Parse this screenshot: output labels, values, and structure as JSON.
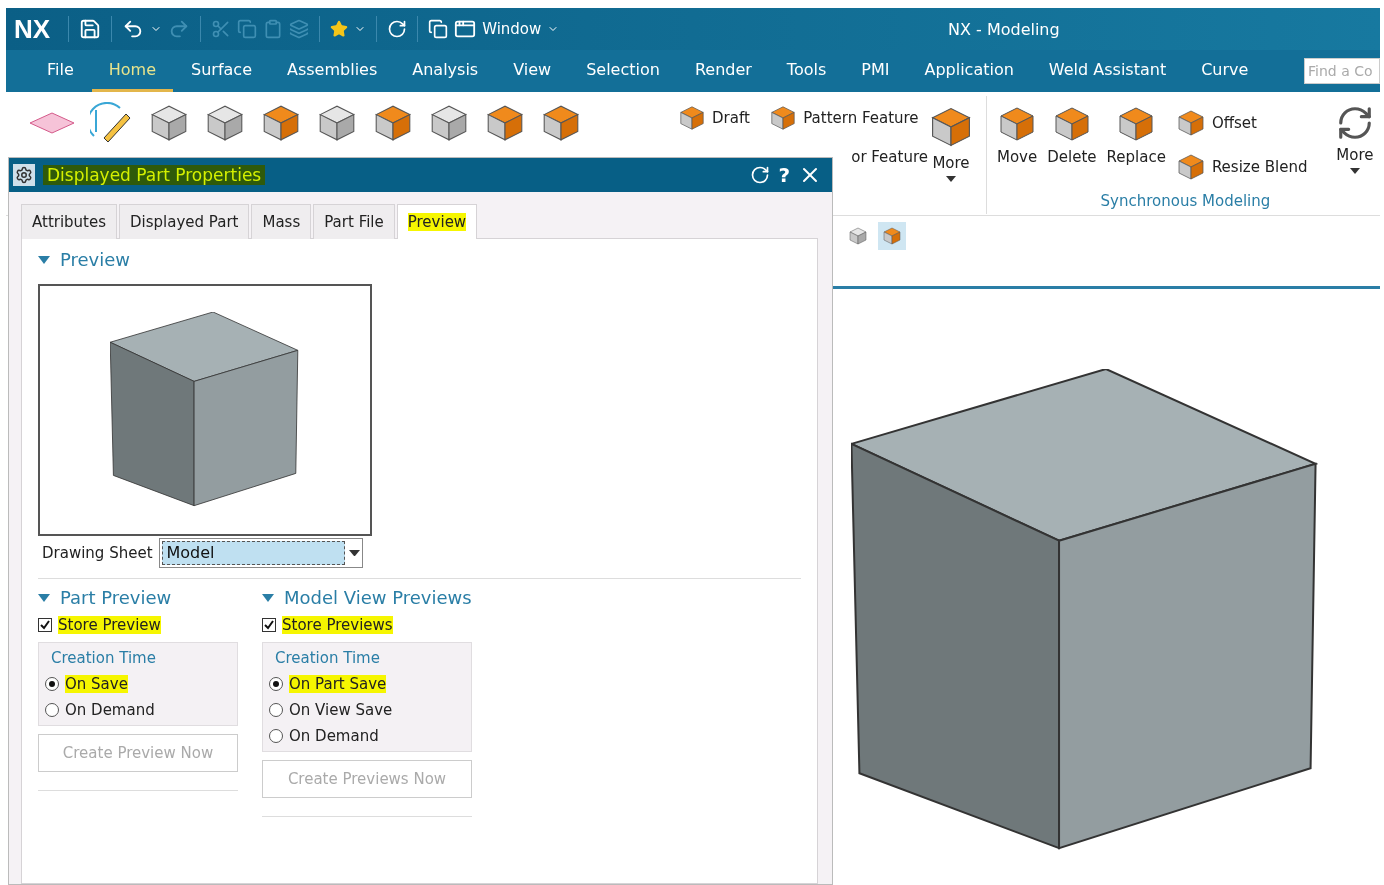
{
  "app": {
    "logo": "NX",
    "window_menu": "Window",
    "title": "NX - Modeling"
  },
  "menu_tabs": [
    {
      "label": "File",
      "selected": false
    },
    {
      "label": "Home",
      "selected": true
    },
    {
      "label": "Surface",
      "selected": false
    },
    {
      "label": "Assemblies",
      "selected": false
    },
    {
      "label": "Analysis",
      "selected": false
    },
    {
      "label": "View",
      "selected": false
    },
    {
      "label": "Selection",
      "selected": false
    },
    {
      "label": "Render",
      "selected": false
    },
    {
      "label": "Tools",
      "selected": false
    },
    {
      "label": "PMI",
      "selected": false
    },
    {
      "label": "Application",
      "selected": false
    },
    {
      "label": "Weld Assistant",
      "selected": false
    },
    {
      "label": "Curve",
      "selected": false
    }
  ],
  "search": {
    "placeholder": "Find a Co"
  },
  "ribbon": {
    "feature_tools": [
      "Draft",
      "Pattern Feature",
      "or Feature"
    ],
    "feature_more": "More",
    "sync_group": {
      "title": "Synchronous Modeling",
      "tools": [
        "Move",
        "Delete",
        "Replace"
      ],
      "side_tools": [
        "Offset",
        "Resize Blend"
      ],
      "more": "More"
    }
  },
  "view_toolbar": [
    {
      "selected": false
    },
    {
      "selected": true
    }
  ],
  "dialog": {
    "title": "Displayed Part Properties",
    "title_highlighted": true,
    "help_glyph": "?",
    "tabs": [
      {
        "label": "Attributes",
        "selected": false,
        "highlighted": false
      },
      {
        "label": "Displayed Part",
        "selected": false,
        "highlighted": false
      },
      {
        "label": "Mass",
        "selected": false,
        "highlighted": false
      },
      {
        "label": "Part File",
        "selected": false,
        "highlighted": false
      },
      {
        "label": "Preview",
        "selected": true,
        "highlighted": true
      }
    ],
    "preview_section": {
      "title": "Preview",
      "expanded": true,
      "drawing_sheet_label": "Drawing Sheet",
      "drawing_sheet_value": "Model"
    },
    "groups": [
      {
        "title": "Part Preview",
        "expanded": true,
        "store": {
          "label": "Store Preview",
          "checked": true,
          "highlighted": true
        },
        "creation_title": "Creation Time",
        "options": [
          {
            "label": "On Save",
            "selected": true,
            "highlighted": true
          },
          {
            "label": "On Demand",
            "selected": false,
            "highlighted": false
          }
        ],
        "button": {
          "label": "Create Preview Now",
          "disabled": true
        }
      },
      {
        "title": "Model View Previews",
        "expanded": true,
        "store": {
          "label": "Store Previews",
          "checked": true,
          "highlighted": true
        },
        "creation_title": "Creation Time",
        "options": [
          {
            "label": "On Part Save",
            "selected": true,
            "highlighted": true
          },
          {
            "label": "On View Save",
            "selected": false,
            "highlighted": false
          },
          {
            "label": "On Demand",
            "selected": false,
            "highlighted": false
          }
        ],
        "button": {
          "label": "Create Previews Now",
          "disabled": true
        }
      }
    ]
  }
}
